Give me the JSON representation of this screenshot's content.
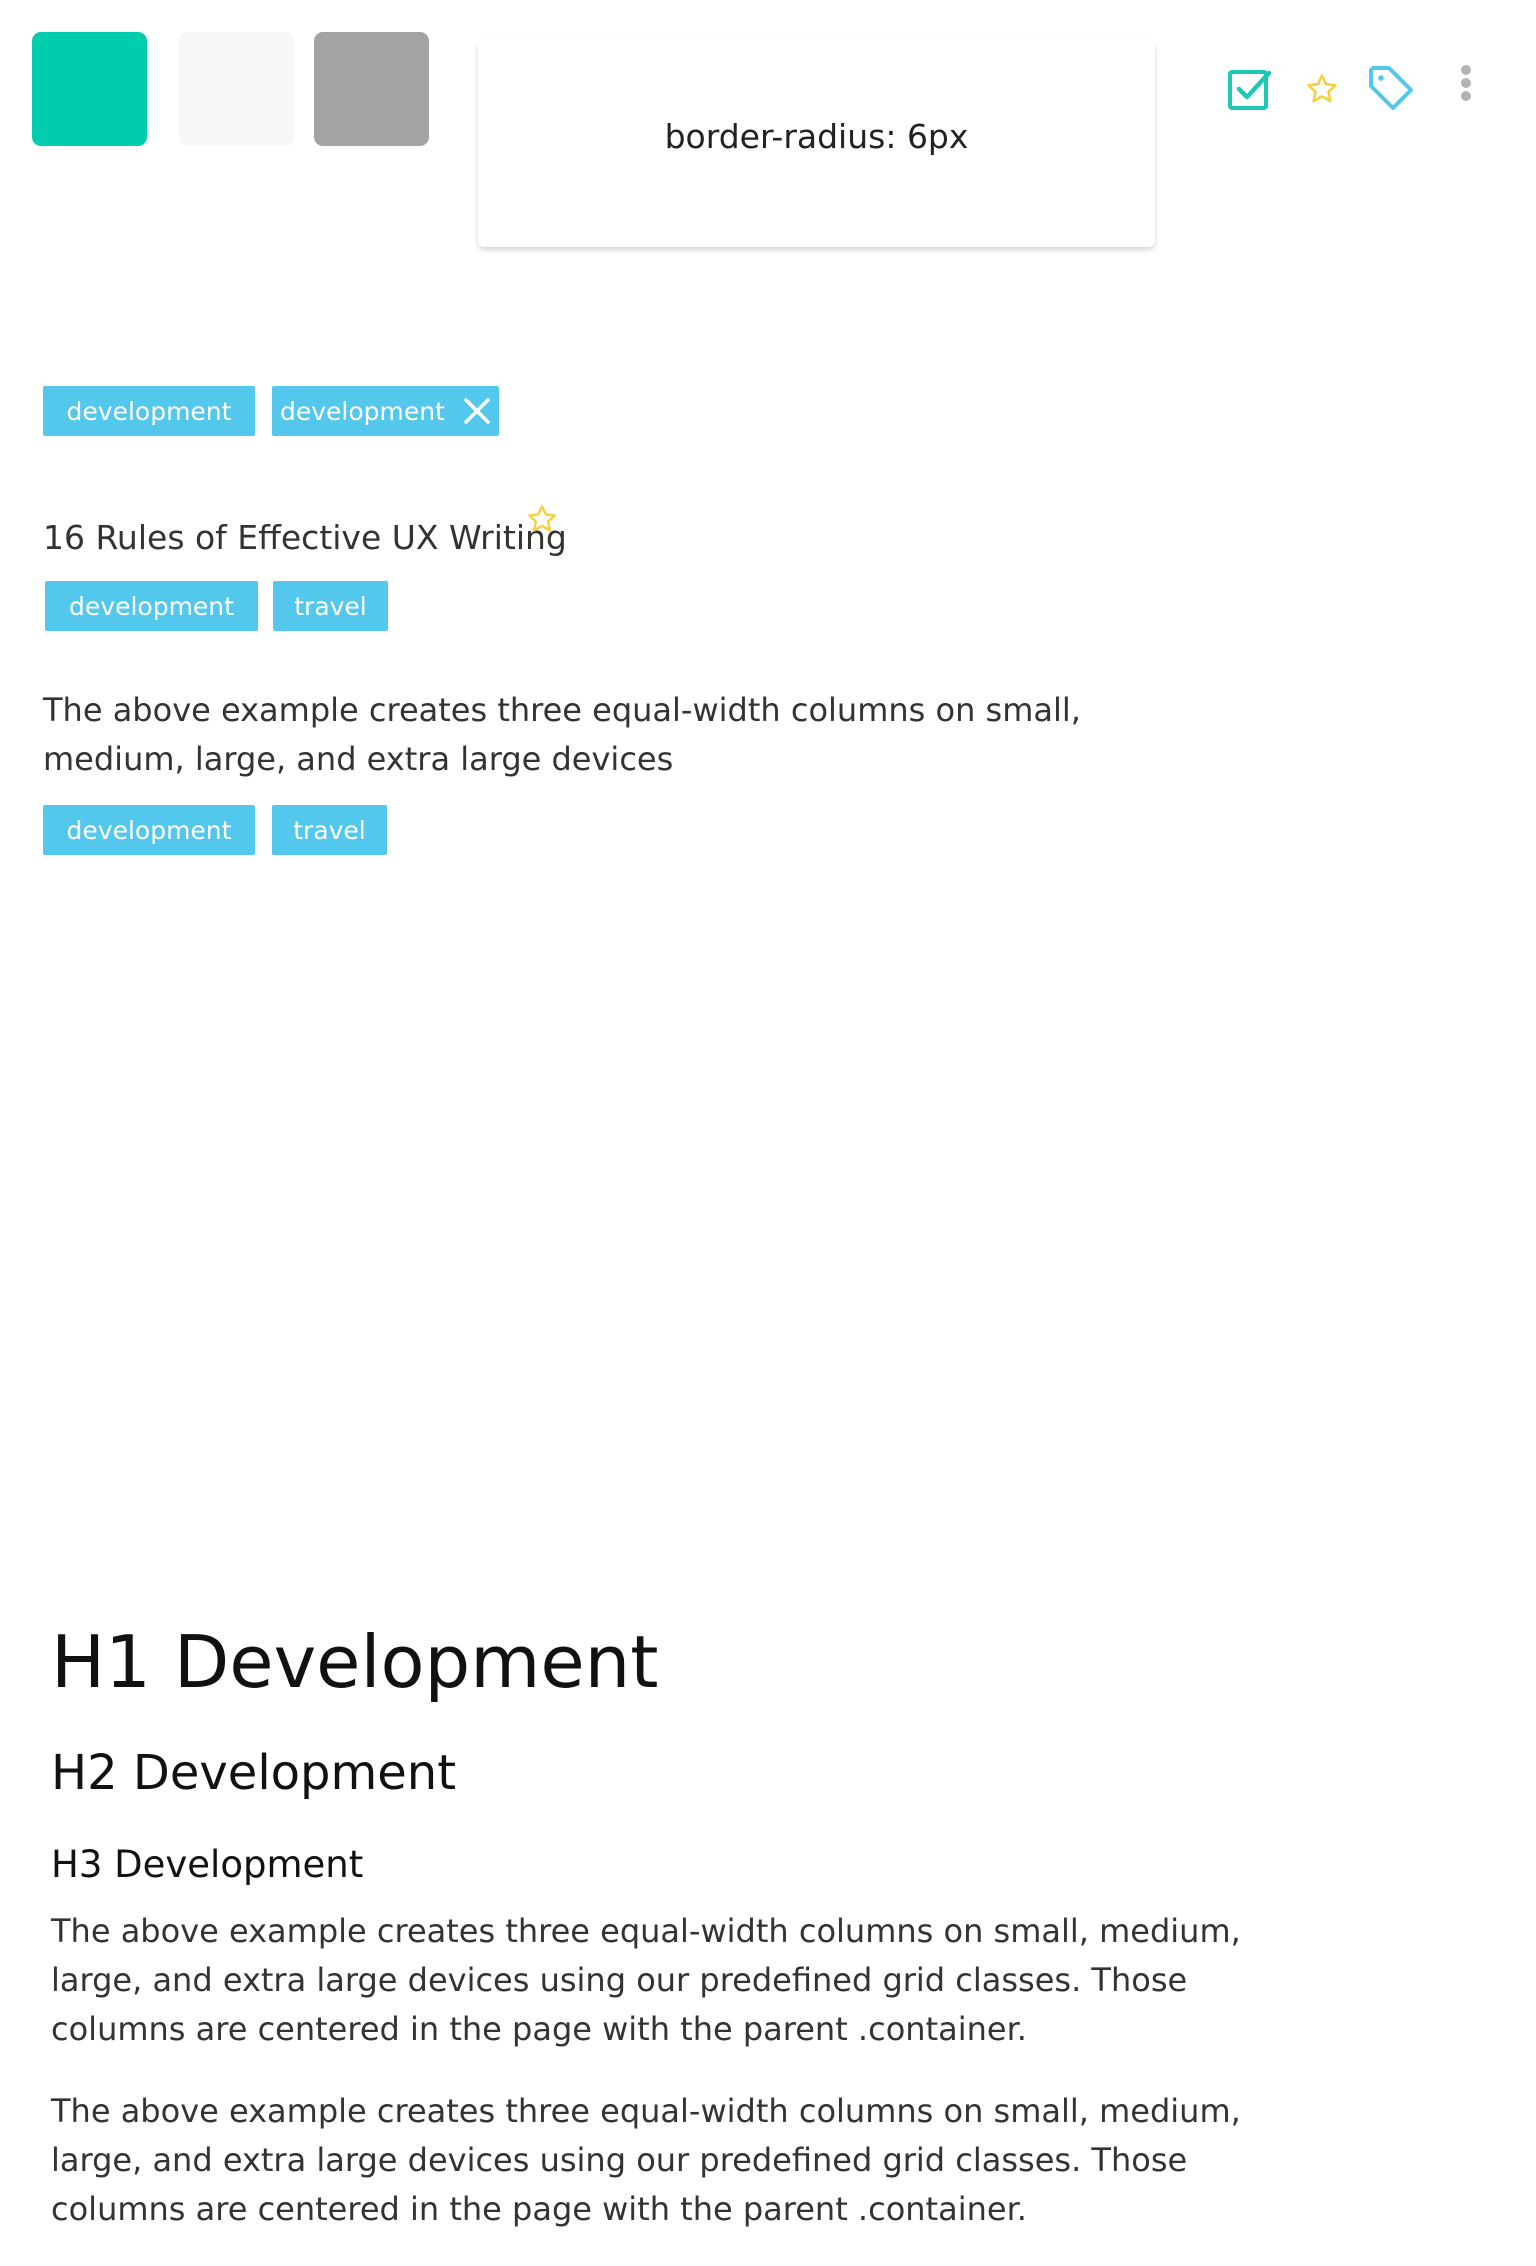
{
  "colors": {
    "swatches": [
      "#00cdae",
      "#f7f7f7",
      "#a3a3a3"
    ],
    "tag_background": "#54c7ec",
    "check_icon": "#1ec9b3",
    "star_icon": "#f8cf3c",
    "tag_icon": "#54c7ec",
    "more_icon": "#b3b3b3"
  },
  "radius_card": {
    "label": "border-radius: 6px"
  },
  "toolbar_icons": [
    "check-square-icon",
    "star-icon",
    "tag-icon",
    "more-vertical-icon"
  ],
  "tags_demo": {
    "plain": "development",
    "removable": "development"
  },
  "article": {
    "title": "16 Rules of Effective UX Writing",
    "tags": [
      "development",
      "travel"
    ],
    "description": "The above example creates three equal-width columns on small, medium, large, and extra large devices",
    "desc_tags": [
      "development",
      "travel"
    ]
  },
  "typography": {
    "h1": "H1 Development",
    "h2": "H2 Development",
    "h3": "H3 Development",
    "paragraph_1": "The above example creates three equal-width columns on small, medium, large, and extra large devices using our predefined grid classes. Those columns are centered in the page with the parent .container.",
    "paragraph_2": "The above example creates three equal-width columns on small, medium, large, and extra large devices using our predefined grid classes. Those columns are centered in the page with the parent .container."
  }
}
